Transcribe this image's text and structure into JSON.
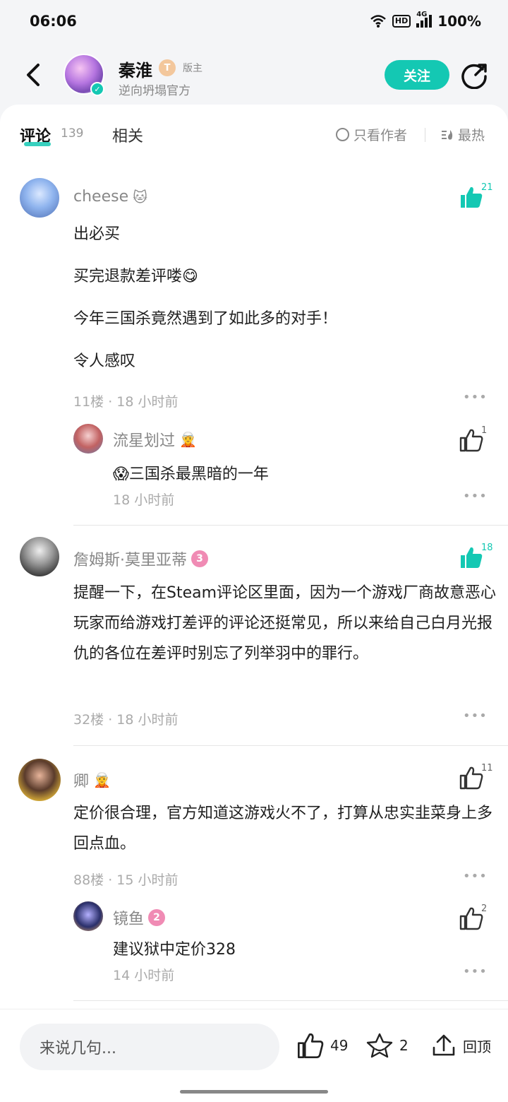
{
  "status_bar": {
    "time": "06:06",
    "network": "4G",
    "hd": "HD",
    "battery": "100%"
  },
  "header": {
    "author_name": "秦淮",
    "author_badge": "T",
    "author_role": "版主",
    "author_sub": "逆向坍塌官方",
    "follow_label": "关注"
  },
  "tabs": {
    "comments_label": "评论",
    "comments_count": "139",
    "related_label": "相关",
    "only_author_label": "只看作者",
    "sort_label": "最热"
  },
  "comments": [
    {
      "name": "cheese",
      "emoji": "🐱",
      "likes": "21",
      "lines": [
        "出必买",
        "买完退款差评喽😋",
        "今年三国杀竟然遇到了如此多的对手！",
        "令人感叹"
      ],
      "meta": "11楼 · 18 小时前",
      "reply": {
        "name": "流星划过",
        "emoji": "🧝",
        "likes": "1",
        "text": "😱三国杀最黑暗的一年",
        "meta": "18 小时前"
      }
    },
    {
      "name": "詹姆斯·莫里亚蒂",
      "level": "3",
      "likes": "18",
      "text": "提醒一下，在Steam评论区里面，因为一个游戏厂商故意恶心玩家而给游戏打差评的评论还挺常见，所以来给自己白月光报仇的各位在差评时别忘了列举羽中的罪行。",
      "meta": "32楼 · 18 小时前"
    },
    {
      "name": "卿",
      "emoji": "🧝",
      "likes": "11",
      "text": "定价很合理，官方知道这游戏火不了，打算从忠实韭菜身上多回点血。",
      "meta": "88楼 · 15 小时前",
      "reply": {
        "name": "镜鱼",
        "level": "2",
        "likes": "2",
        "text": "建议狱中定价328",
        "meta": "14 小时前"
      }
    }
  ],
  "bottom_bar": {
    "input_placeholder": "来说几句...",
    "like_count": "49",
    "favorite_count": "2",
    "top_label": "回顶"
  },
  "colors": {
    "accent": "#14c8b3",
    "level_badge": "#f08bb4"
  }
}
